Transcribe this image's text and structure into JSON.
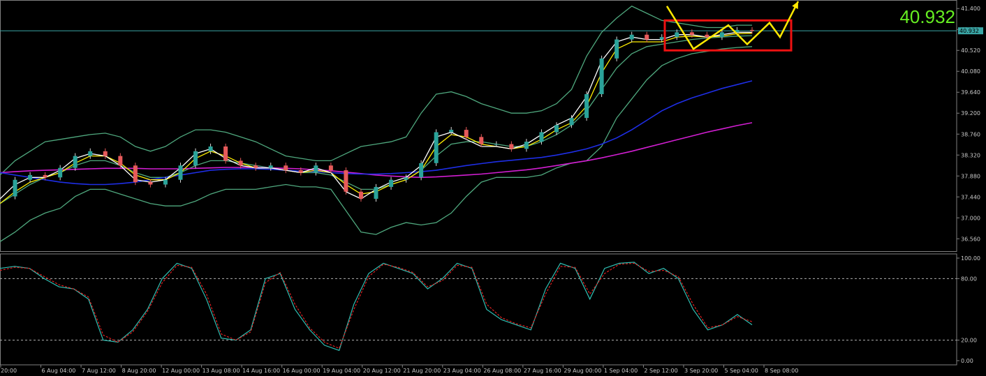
{
  "chart_data": {
    "type": "line",
    "price_panel": {
      "current_price": "40.932",
      "current_value": 40.932,
      "ylim": [
        36.3,
        41.55
      ],
      "yticks": [
        "41.400",
        "40.960",
        "40.520",
        "40.080",
        "39.640",
        "39.200",
        "38.760",
        "38.320",
        "37.880",
        "37.440",
        "37.000",
        "36.560"
      ],
      "xticks": [
        "20:00",
        "6 Aug 04:00",
        "7 Aug 12:00",
        "8 Aug 20:00",
        "12 Aug 00:00",
        "13 Aug 08:00",
        "14 Aug 16:00",
        "16 Aug 00:00",
        "19 Aug 04:00",
        "20 Aug 12:00",
        "21 Aug 20:00",
        "23 Aug 04:00",
        "26 Aug 08:00",
        "27 Aug 16:00",
        "29 Aug 00:00",
        "1 Sep 04:00",
        "2 Sep 12:00",
        "3 Sep 20:00",
        "5 Sep 04:00",
        "8 Sep 08:00"
      ],
      "series": [
        {
          "role": "close",
          "color": "#d8d8d8",
          "values": [
            37.45,
            37.8,
            37.9,
            37.85,
            38.05,
            38.3,
            38.4,
            38.3,
            38.1,
            37.75,
            37.7,
            37.8,
            38.1,
            38.4,
            38.5,
            38.2,
            38.1,
            38.05,
            38.1,
            38.0,
            37.95,
            38.1,
            38.0,
            37.55,
            37.4,
            37.65,
            37.8,
            37.85,
            38.15,
            38.8,
            38.85,
            38.7,
            38.55,
            38.55,
            38.45,
            38.6,
            38.8,
            38.95,
            39.1,
            39.6,
            40.35,
            40.75,
            40.85,
            40.75,
            40.8,
            40.9,
            40.85,
            40.8,
            40.9,
            40.95,
            40.93
          ]
        },
        {
          "role": "fast-ma",
          "color": "#ffffff",
          "values": [
            37.4,
            37.7,
            37.85,
            37.85,
            38.0,
            38.25,
            38.35,
            38.3,
            38.1,
            37.8,
            37.75,
            37.8,
            38.05,
            38.35,
            38.45,
            38.25,
            38.1,
            38.05,
            38.05,
            38.0,
            37.95,
            38.05,
            37.95,
            37.55,
            37.4,
            37.6,
            37.75,
            37.85,
            38.1,
            38.7,
            38.8,
            38.65,
            38.5,
            38.5,
            38.45,
            38.55,
            38.75,
            38.95,
            39.1,
            39.55,
            40.3,
            40.7,
            40.8,
            40.75,
            40.75,
            40.85,
            40.85,
            40.8,
            40.85,
            40.9,
            40.9
          ]
        },
        {
          "role": "slow-ma",
          "color": "#ffee00",
          "values": [
            37.3,
            37.55,
            37.75,
            37.85,
            37.95,
            38.15,
            38.3,
            38.3,
            38.15,
            37.9,
            37.8,
            37.8,
            37.95,
            38.25,
            38.4,
            38.3,
            38.15,
            38.05,
            38.05,
            38.0,
            37.95,
            38.0,
            37.95,
            37.7,
            37.5,
            37.55,
            37.7,
            37.8,
            38.0,
            38.5,
            38.75,
            38.7,
            38.55,
            38.5,
            38.45,
            38.5,
            38.65,
            38.85,
            39.0,
            39.35,
            40.05,
            40.55,
            40.7,
            40.7,
            40.7,
            40.8,
            40.82,
            40.8,
            40.82,
            40.87,
            40.88
          ]
        },
        {
          "role": "bollinger-upper",
          "color": "#4fa87e",
          "values": [
            37.9,
            38.2,
            38.4,
            38.6,
            38.65,
            38.7,
            38.75,
            38.78,
            38.7,
            38.5,
            38.4,
            38.5,
            38.7,
            38.85,
            38.85,
            38.8,
            38.7,
            38.6,
            38.45,
            38.3,
            38.25,
            38.2,
            38.2,
            38.35,
            38.5,
            38.55,
            38.6,
            38.7,
            39.2,
            39.6,
            39.65,
            39.55,
            39.4,
            39.3,
            39.2,
            39.2,
            39.25,
            39.4,
            39.7,
            40.4,
            40.9,
            41.2,
            41.45,
            41.3,
            41.15,
            41.1,
            41.05,
            41.0,
            41.0,
            41.05,
            41.05
          ]
        },
        {
          "role": "bollinger-middle",
          "color": "#4fa87e",
          "values": [
            37.3,
            37.5,
            37.7,
            37.85,
            37.95,
            38.1,
            38.2,
            38.2,
            38.1,
            37.95,
            37.85,
            37.85,
            37.95,
            38.1,
            38.2,
            38.2,
            38.15,
            38.1,
            38.05,
            38.0,
            37.95,
            37.95,
            37.9,
            37.75,
            37.6,
            37.6,
            37.7,
            37.8,
            38.0,
            38.3,
            38.55,
            38.6,
            38.6,
            38.55,
            38.5,
            38.5,
            38.6,
            38.75,
            38.95,
            39.25,
            39.7,
            40.15,
            40.45,
            40.6,
            40.65,
            40.7,
            40.75,
            40.78,
            40.8,
            40.82,
            40.83
          ]
        },
        {
          "role": "bollinger-lower",
          "color": "#4fa87e",
          "values": [
            36.5,
            36.7,
            36.95,
            37.1,
            37.2,
            37.45,
            37.6,
            37.6,
            37.5,
            37.4,
            37.3,
            37.25,
            37.25,
            37.35,
            37.5,
            37.6,
            37.6,
            37.6,
            37.65,
            37.7,
            37.65,
            37.65,
            37.6,
            37.15,
            36.7,
            36.65,
            36.8,
            36.9,
            36.85,
            36.9,
            37.1,
            37.45,
            37.75,
            37.85,
            37.85,
            37.85,
            37.9,
            38.05,
            38.15,
            38.2,
            38.5,
            39.1,
            39.5,
            39.9,
            40.2,
            40.35,
            40.45,
            40.5,
            40.55,
            40.58,
            40.6
          ]
        },
        {
          "role": "ma-blue",
          "color": "#1e2ee6",
          "values": [
            37.95,
            37.9,
            37.85,
            37.8,
            37.75,
            37.72,
            37.7,
            37.7,
            37.72,
            37.75,
            37.8,
            37.85,
            37.9,
            37.95,
            38.0,
            38.02,
            38.03,
            38.03,
            38.02,
            38.0,
            37.98,
            37.97,
            37.95,
            37.93,
            37.92,
            37.92,
            37.93,
            37.95,
            37.97,
            38.0,
            38.05,
            38.1,
            38.14,
            38.18,
            38.21,
            38.24,
            38.27,
            38.32,
            38.38,
            38.45,
            38.55,
            38.68,
            38.85,
            39.05,
            39.25,
            39.4,
            39.52,
            39.62,
            39.72,
            39.8,
            39.88
          ]
        },
        {
          "role": "ma-magenta",
          "color": "#d21ed2",
          "values": [
            37.95,
            37.97,
            37.99,
            38.0,
            38.01,
            38.02,
            38.03,
            38.04,
            38.04,
            38.04,
            38.03,
            38.03,
            38.03,
            38.04,
            38.05,
            38.06,
            38.06,
            38.06,
            38.05,
            38.04,
            38.03,
            38.01,
            37.99,
            37.96,
            37.93,
            37.9,
            37.88,
            37.86,
            37.85,
            37.86,
            37.88,
            37.9,
            37.92,
            37.95,
            37.98,
            38.01,
            38.05,
            38.1,
            38.15,
            38.2,
            38.26,
            38.33,
            38.4,
            38.48,
            38.56,
            38.64,
            38.72,
            38.8,
            38.87,
            38.94,
            39.0
          ]
        }
      ]
    },
    "oscillator_panel": {
      "ylim": [
        0,
        100
      ],
      "yticks": [
        "100.00",
        "80.00",
        "20.00",
        "0.00"
      ],
      "levels": [
        80,
        20
      ],
      "main_values": [
        90,
        92,
        90,
        80,
        72,
        70,
        60,
        20,
        18,
        30,
        50,
        80,
        95,
        90,
        60,
        22,
        20,
        30,
        80,
        85,
        50,
        30,
        15,
        10,
        55,
        85,
        95,
        90,
        85,
        70,
        80,
        95,
        90,
        50,
        40,
        35,
        30,
        70,
        95,
        90,
        60,
        90,
        95,
        96,
        85,
        90,
        80,
        50,
        30,
        35,
        45,
        35
      ],
      "signal_values": [
        88,
        91,
        90,
        82,
        74,
        70,
        62,
        25,
        18,
        28,
        48,
        76,
        93,
        91,
        65,
        26,
        20,
        28,
        76,
        86,
        55,
        32,
        18,
        12,
        50,
        82,
        94,
        91,
        86,
        72,
        78,
        93,
        91,
        55,
        42,
        36,
        32,
        65,
        92,
        91,
        65,
        85,
        94,
        95,
        87,
        88,
        82,
        55,
        32,
        35,
        43,
        38
      ]
    },
    "annotations": {
      "zone_color": "#ee1111",
      "arrow_color": "#ffe800"
    }
  }
}
